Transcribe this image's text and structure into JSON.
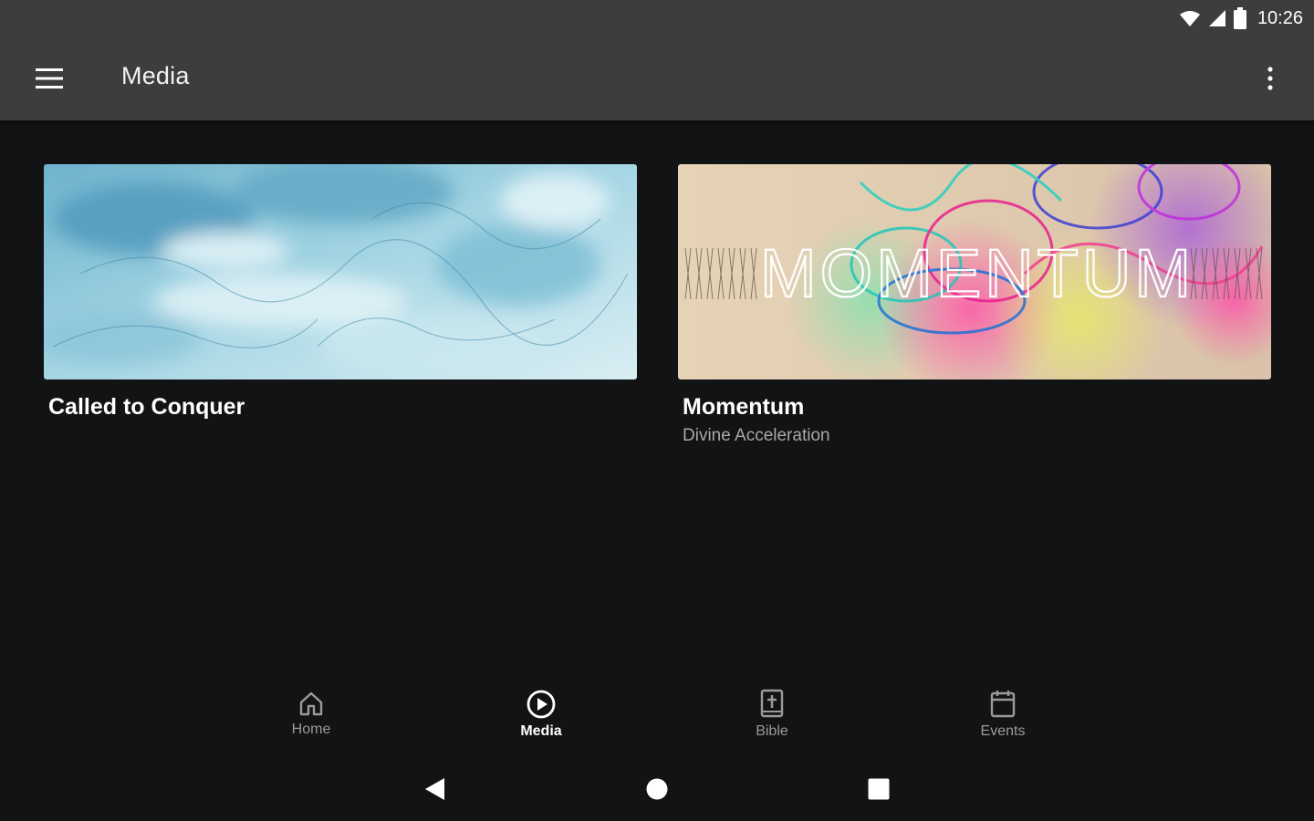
{
  "status_bar": {
    "time": "10:26",
    "icons": [
      "wifi-icon",
      "cell-signal-icon",
      "battery-icon"
    ]
  },
  "app_bar": {
    "title": "Media",
    "menu_icon": "hamburger-menu-icon",
    "overflow_icon": "more-vertical-icon"
  },
  "cards": [
    {
      "title": "Called to Conquer",
      "subtitle": "",
      "image": "blue-marble-texture"
    },
    {
      "title": "Momentum",
      "subtitle": "Divine Acceleration",
      "image_text": "MOMENTUM",
      "image": "colorful-abstract-graphic"
    }
  ],
  "bottom_nav": {
    "items": [
      {
        "label": "Home",
        "icon": "home-icon",
        "active": false
      },
      {
        "label": "Media",
        "icon": "play-circle-icon",
        "active": true
      },
      {
        "label": "Bible",
        "icon": "bible-icon",
        "active": false
      },
      {
        "label": "Events",
        "icon": "calendar-icon",
        "active": false
      }
    ]
  },
  "system_nav": {
    "icons": [
      "back-icon",
      "home-circle-icon",
      "recents-square-icon"
    ]
  },
  "colors": {
    "background": "#121315",
    "app_bar": "#3d3d3d",
    "nav_inactive": "#9a9a9a",
    "nav_active": "#ffffff"
  }
}
